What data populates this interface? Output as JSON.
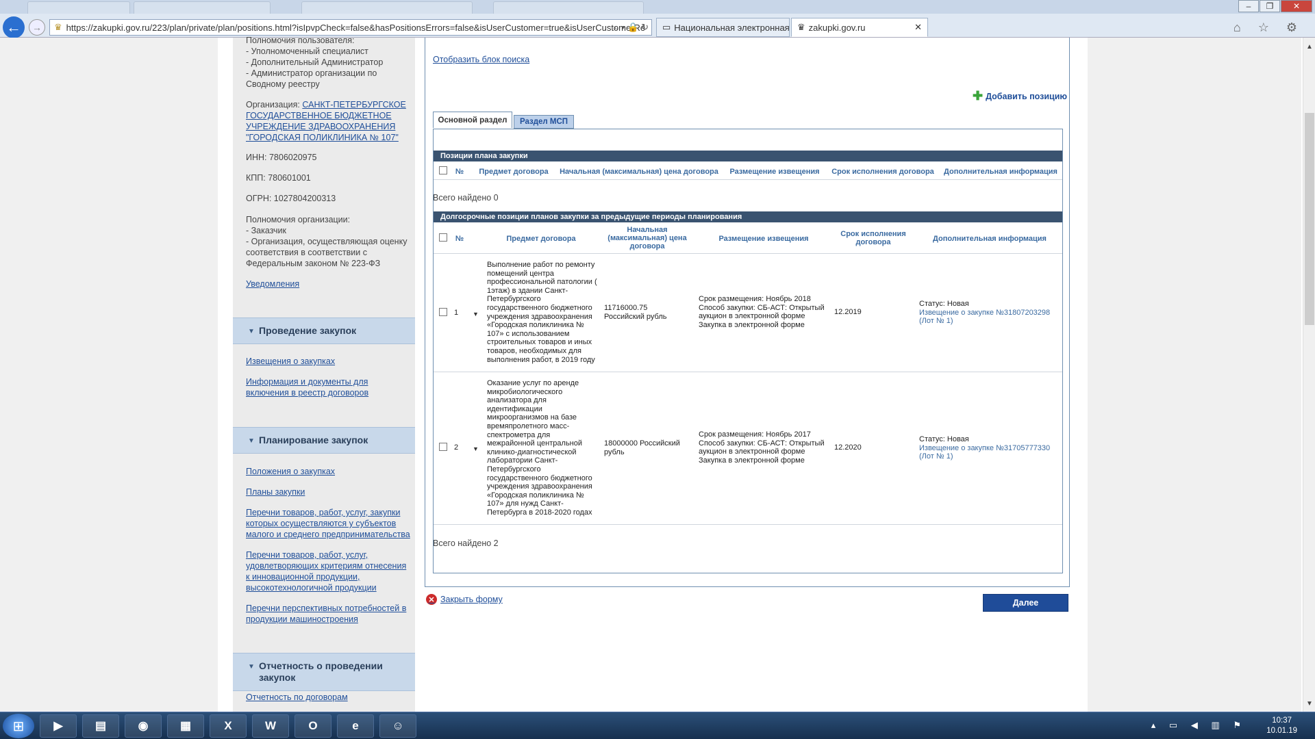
{
  "browser": {
    "back_icon": "back-arrow-icon",
    "address": "https://zakupki.gov.ru/223/plan/private/plan/positions.html?isIpvpCheck=false&hasPositionsErrors=false&isUserCustomer=true&isUserCustomerRe",
    "address_tools": "⌕ ▾ 🔒 ↻",
    "tabs": [
      {
        "label": "Национальная электронная ..."
      },
      {
        "label": "zakupki.gov.ru",
        "close": "✕"
      }
    ],
    "toolbar_icons": "⌂ ☆ ⚙"
  },
  "sidebar": {
    "user_powers_title": "Полномочия пользователя:",
    "user_powers": [
      "- Уполномоченный специалист",
      "- Дополнительный Администратор",
      "- Администратор организации по Сводному реестру"
    ],
    "org_label": "Организация:",
    "org_name": "САНКТ-ПЕТЕРБУРГСКОЕ ГОСУДАРСТВЕННОЕ БЮДЖЕТНОЕ УЧРЕЖДЕНИЕ ЗДРАВООХРАНЕНИЯ \"ГОРОДСКАЯ ПОЛИКЛИНИКА № 107\"",
    "inn": "ИНН: 7806020975",
    "kpp": "КПП: 780601001",
    "ogrn": "ОГРН: 1027804200313",
    "org_powers_title": "Полномочия организации:",
    "org_powers": [
      "- Заказчик",
      "- Организация, осуществляющая оценку соответствия в соответствии с Федеральным законом № 223-ФЗ"
    ],
    "notifications": "Уведомления",
    "sections": [
      {
        "title": "Проведение закупок",
        "links": [
          "Извещения о закупках",
          "Информация и документы для включения в реестр договоров"
        ]
      },
      {
        "title": "Планирование закупок",
        "links": [
          "Положения о закупках",
          "Планы закупки",
          "Перечни товаров, работ, услуг, закупки которых осуществляются у субъектов малого и среднего предпринимательства",
          "Перечни товаров, работ, услуг, удовлетворяющих критериям отнесения к инновационной продукции, высокотехнологичной продукции",
          "Перечни перспективных потребностей в продукции машиностроения"
        ]
      },
      {
        "title": "Отчетность о проведении закупок",
        "links": [
          "Отчетность по договорам"
        ]
      }
    ]
  },
  "main": {
    "show_search": "Отобразить блок поиска",
    "add_position": "Добавить позицию",
    "tabs": [
      {
        "label": "Основной раздел",
        "active": true
      },
      {
        "label": "Раздел МСП",
        "active": false
      }
    ],
    "section1": {
      "title": "Позиции плана закупки",
      "columns": [
        "№",
        "Предмет договора",
        "Начальная (максимальная) цена договора",
        "Размещение извещения",
        "Срок исполнения договора",
        "Дополнительная информация"
      ],
      "found": "Всего найдено 0"
    },
    "section2": {
      "title": "Долгосрочные позиции планов закупки за предыдущие периоды планирования",
      "columns": [
        "№",
        "Предмет договора",
        "Начальная (максимальная) цена договора",
        "Размещение извещения",
        "Срок исполнения договора",
        "Дополнительная информация"
      ],
      "rows": [
        {
          "num": "1",
          "subject": "Выполнение работ по ремонту помещений центра профессиональной патологии ( 1этаж) в здании Санкт-Петербургского государственного бюджетного учреждения здравоохранения «Городская поликлиника № 107» с использованием строительных товаров и иных товаров, необходимых для выполнения работ, в 2019 году",
          "price": "11716000.75 Российский рубль",
          "placement": [
            "Срок размещения: Ноябрь 2018",
            "Способ закупки: СБ-АСТ: Открытый аукцион в электронной форме",
            "Закупка в электронной форме"
          ],
          "term": "12.2019",
          "status": "Статус: Новая",
          "link": "Извещение о закупке №31807203298 (Лот № 1)"
        },
        {
          "num": "2",
          "subject": "Оказание услуг по аренде микробиологического анализатора для идентификации микроорганизмов на базе времяпролетного масс-спектрометра для межрайонной центральной клинико-диагностической лаборатории Санкт-Петербургского государственного бюджетного учреждения здравоохранения «Городская поликлиника № 107» для нужд Санкт-Петербурга в 2018-2020 годах",
          "price": "18000000 Российский рубль",
          "placement": [
            "Срок размещения: Ноябрь 2017",
            "Способ закупки: СБ-АСТ: Открытый аукцион в электронной форме",
            "Закупка в электронной форме"
          ],
          "term": "12.2020",
          "status": "Статус: Новая",
          "link": "Извещение о закупке №31705777330 (Лот № 1)"
        }
      ],
      "found": "Всего найдено 2"
    },
    "close_form": "Закрыть форму",
    "next": "Далее"
  },
  "taskbar": {
    "apps": [
      "▶",
      "▤",
      "◉",
      "▦",
      "X",
      "W",
      "O",
      "e",
      "☺"
    ],
    "tray": "▴ ▭ ◀ ▥ ⚑",
    "time": "10:37",
    "date": "10.01.19"
  },
  "colors": {
    "accent": "#1f4c99",
    "section_header": "#3a5370",
    "sidebar_header": "#c8d8ea"
  }
}
